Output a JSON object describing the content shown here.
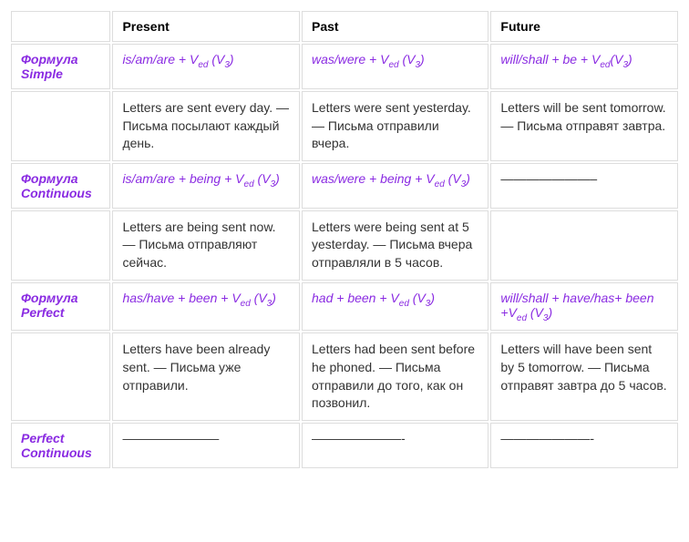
{
  "headers": {
    "col0": "",
    "col1": "Present",
    "col2": "Past",
    "col3": "Future"
  },
  "rows": {
    "simple": {
      "label": "Формула Simple",
      "formula_present_before": "is/am/are + V",
      "formula_present_sub": "ed",
      "formula_present_after": " (V",
      "formula_present_sub2": "3",
      "formula_present_close": ")",
      "formula_past_before": "was/were + V",
      "formula_past_sub": "ed",
      "formula_past_after": " (V",
      "formula_past_sub2": "3",
      "formula_past_close": ")",
      "formula_future_before": "will/shall + be + V",
      "formula_future_sub": "ed",
      "formula_future_after": "(V",
      "formula_future_sub2": "3",
      "formula_future_close": ")",
      "example_present": "   Letters are sent every day. — Письма посылают каждый день.",
      "example_past": "   Letters were sent yesterday. — Письма отправили вчера.",
      "example_future": "   Letters will be sent tomorrow. — Письма отправят завтра."
    },
    "continuous": {
      "label": "Формула Continuous",
      "formula_present_before": "is/am/are + being + V",
      "formula_present_sub": "ed",
      "formula_present_after": " (V",
      "formula_present_sub2": "3",
      "formula_present_close": ")",
      "formula_past_before": "was/were + being + V",
      "formula_past_sub": "ed",
      "formula_past_after": " (V",
      "formula_past_sub2": "3",
      "formula_past_close": ")",
      "formula_future": "———————–",
      "example_present": "   Letters are being sent now. — Письма отправляют сейчас.",
      "example_past": "   Letters were being sent at 5 yesterday. — Письма вчера отправляли в 5 часов.",
      "example_future": ""
    },
    "perfect": {
      "label": "Формула Perfect",
      "formula_present_before": "has/have + been + V",
      "formula_present_sub": "ed",
      "formula_present_after": " (V",
      "formula_present_sub2": "3",
      "formula_present_close": ")",
      "formula_past_before": "had + been + V",
      "formula_past_sub": "ed",
      "formula_past_after": " (V",
      "formula_past_sub2": "3",
      "formula_past_close": ")",
      "formula_future_before": "will/shall + have/has+ been +V",
      "formula_future_sub": "ed",
      "formula_future_after": " (V",
      "formula_future_sub2": "3",
      "formula_future_close": ")",
      "example_present": "   Letters have been already sent. — Письма уже отправили.",
      "example_past": "   Letters had been sent before he phoned. — Письма отправили до того, как он позвонил.",
      "example_future": "   Letters will have been sent by 5 tomorrow. — Письма отправят завтра до 5 часов."
    },
    "perfect_continuous": {
      "label": "Perfect Continuous",
      "formula_present": "———————–",
      "formula_past": "———————-",
      "formula_future": "———————-"
    }
  }
}
